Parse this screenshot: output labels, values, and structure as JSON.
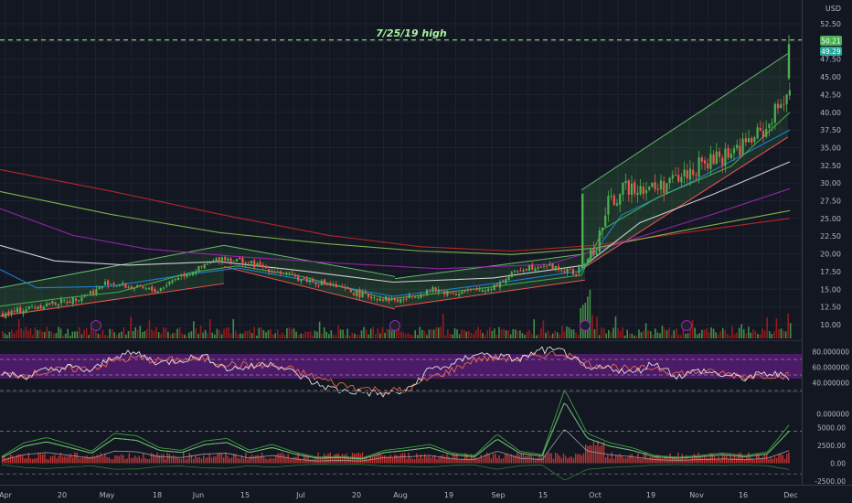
{
  "price_panel": {
    "annotation": "7/25/19 high",
    "currency": "USD",
    "last_price": "50.21",
    "price_line_label": "49.29"
  },
  "chart_data": [
    {
      "type": "candlestick",
      "y_axis_labels": [
        "52.50",
        "50.00",
        "47.50",
        "45.00",
        "42.50",
        "40.00",
        "37.50",
        "35.00",
        "32.50",
        "30.00",
        "27.50",
        "25.00",
        "22.50",
        "20.00",
        "17.50",
        "15.00",
        "12.50",
        "10.00"
      ],
      "x_axis_labels": [
        "Apr",
        "20",
        "May",
        "18",
        "Jun",
        "15",
        "Jul",
        "20",
        "Aug",
        "19",
        "Sep",
        "15",
        "Oct",
        "19",
        "Nov",
        "16",
        "Dec"
      ],
      "ylim": [
        8.5,
        54
      ],
      "horizontal_line": 50.21,
      "close_series": [
        {
          "x": "Apr 1",
          "y": 11.5
        },
        {
          "x": "Apr 10",
          "y": 12.6
        },
        {
          "x": "Apr 20",
          "y": 13.4
        },
        {
          "x": "Apr 28",
          "y": 14.9
        },
        {
          "x": "May 1",
          "y": 16.0
        },
        {
          "x": "May 10",
          "y": 15.2
        },
        {
          "x": "May 18",
          "y": 14.8
        },
        {
          "x": "May 25",
          "y": 16.8
        },
        {
          "x": "Jun 1",
          "y": 17.8
        },
        {
          "x": "Jun 8",
          "y": 19.5
        },
        {
          "x": "Jun 15",
          "y": 18.8
        },
        {
          "x": "Jun 22",
          "y": 17.8
        },
        {
          "x": "Jul 1",
          "y": 16.5
        },
        {
          "x": "Jul 10",
          "y": 15.6
        },
        {
          "x": "Jul 20",
          "y": 14.2
        },
        {
          "x": "Jul 28",
          "y": 13.6
        },
        {
          "x": "Aug 1",
          "y": 13.4
        },
        {
          "x": "Aug 10",
          "y": 14.9
        },
        {
          "x": "Aug 19",
          "y": 14.5
        },
        {
          "x": "Aug 28",
          "y": 15.0
        },
        {
          "x": "Sep 1",
          "y": 15.8
        },
        {
          "x": "Sep 8",
          "y": 17.9
        },
        {
          "x": "Sep 15",
          "y": 18.5
        },
        {
          "x": "Sep 25",
          "y": 17.2
        },
        {
          "x": "Oct 1",
          "y": 20.5
        },
        {
          "x": "Oct 5",
          "y": 27.0
        },
        {
          "x": "Oct 12",
          "y": 29.8
        },
        {
          "x": "Oct 19",
          "y": 29.2
        },
        {
          "x": "Oct 26",
          "y": 30.5
        },
        {
          "x": "Nov 1",
          "y": 32.2
        },
        {
          "x": "Nov 8",
          "y": 33.5
        },
        {
          "x": "Nov 16",
          "y": 35.4
        },
        {
          "x": "Nov 23",
          "y": 37.6
        },
        {
          "x": "Nov 28",
          "y": 41.5
        },
        {
          "x": "Dec 1",
          "y": 44.0
        },
        {
          "x": "Dec 3",
          "y": 49.3
        }
      ]
    },
    {
      "type": "line",
      "name": "rsi",
      "y_axis_labels": [
        "80.000000",
        "60.000000",
        "40.000000",
        "0.000000"
      ],
      "ylim": [
        -2,
        92
      ],
      "band": [
        30,
        70
      ],
      "series": [
        {
          "values": [
            52,
            48,
            56,
            60,
            55,
            75,
            78,
            65,
            70,
            74,
            58,
            60,
            66,
            52,
            38,
            30,
            28,
            25,
            29,
            58,
            62,
            78,
            74,
            70,
            82,
            80,
            56,
            60,
            52,
            66,
            48,
            56,
            50,
            46,
            52,
            48
          ]
        },
        {
          "values": [
            50,
            50,
            54,
            58,
            58,
            68,
            72,
            68,
            70,
            70,
            64,
            62,
            62,
            56,
            46,
            38,
            33,
            30,
            30,
            46,
            56,
            70,
            72,
            70,
            76,
            78,
            64,
            62,
            56,
            60,
            52,
            54,
            52,
            48,
            50,
            49
          ]
        }
      ]
    },
    {
      "type": "area",
      "name": "volume-oscillator",
      "y_axis_labels": [
        "5000.00",
        "2500.00",
        "0.00",
        "-2500.00"
      ],
      "ylim": [
        -3200,
        9500
      ],
      "reference_lines": [
        4500,
        -1500
      ],
      "series": [
        {
          "values": [
            800,
            2400,
            3000,
            2200,
            1400,
            3500,
            3200,
            1800,
            1500,
            2600,
            2900,
            1500,
            2200,
            1300,
            700,
            800,
            600,
            1500,
            1800,
            2200,
            1200,
            900,
            3400,
            1400,
            1000,
            8600,
            3500,
            2400,
            1800,
            900,
            700,
            900,
            1200,
            900,
            1300,
            4600
          ]
        },
        {
          "values": [
            400,
            1200,
            1500,
            1100,
            700,
            1700,
            1600,
            900,
            800,
            1300,
            1400,
            700,
            1100,
            600,
            300,
            400,
            300,
            800,
            900,
            1100,
            600,
            500,
            1700,
            700,
            500,
            4800,
            1700,
            1200,
            900,
            500,
            400,
            500,
            600,
            500,
            700,
            1800
          ]
        }
      ]
    }
  ]
}
